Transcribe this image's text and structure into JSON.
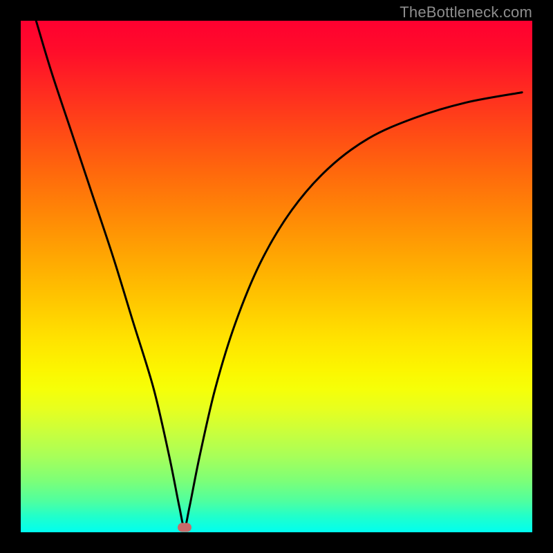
{
  "attribution": "TheBottleneck.com",
  "chart_data": {
    "type": "line",
    "title": "",
    "xlabel": "",
    "ylabel": "",
    "xlim": [
      0,
      100
    ],
    "ylim": [
      0,
      100
    ],
    "grid": false,
    "legend": false,
    "note": "Bottleneck-style curve on a red-yellow-green vertical gradient. Minimum near x≈32. Values are approximate (read off pixels).",
    "series": [
      {
        "name": "bottleneck-curve",
        "x": [
          3,
          6,
          10,
          14,
          18,
          22,
          26,
          29,
          31,
          32,
          33,
          35,
          38,
          42,
          47,
          53,
          60,
          68,
          77,
          87,
          98
        ],
        "y": [
          100,
          90,
          78,
          66,
          54,
          41,
          28,
          15,
          5,
          1,
          5,
          15,
          28,
          41,
          53,
          63,
          71,
          77,
          81,
          84,
          86
        ]
      }
    ],
    "marker": {
      "x": 32,
      "y": 1,
      "color": "#c96a6a"
    },
    "gradient_stops": [
      {
        "pos": 0,
        "color": "#ff0030"
      },
      {
        "pos": 50,
        "color": "#ffc400"
      },
      {
        "pos": 72,
        "color": "#f6ff08"
      },
      {
        "pos": 100,
        "color": "#00fff0"
      }
    ]
  }
}
